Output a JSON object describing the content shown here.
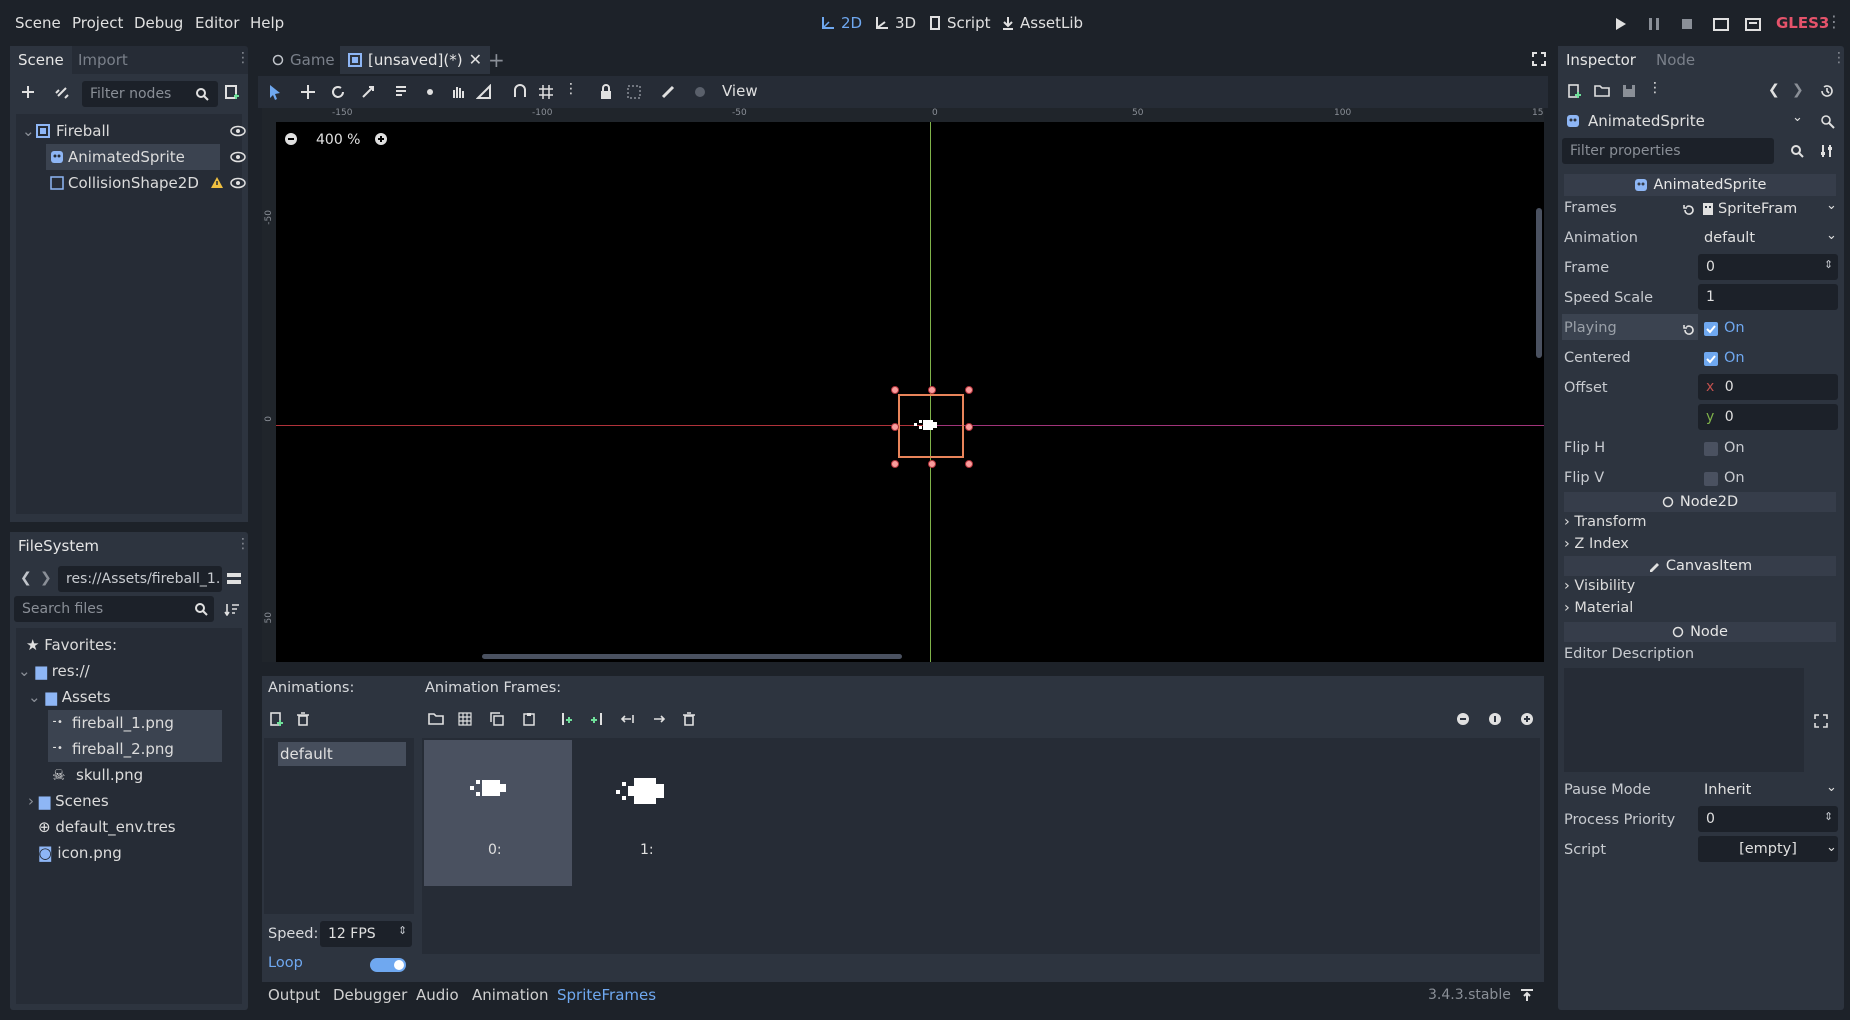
{
  "menu": {
    "scene": "Scene",
    "project": "Project",
    "debug": "Debug",
    "editor": "Editor",
    "help": "Help"
  },
  "workspaces": {
    "two_d": "2D",
    "three_d": "3D",
    "script": "Script",
    "assetlib": "AssetLib"
  },
  "renderer": "GLES3",
  "scene_dock": {
    "tab_scene": "Scene",
    "tab_import": "Import",
    "filter_placeholder": "Filter nodes",
    "nodes": [
      {
        "label": "Fireball",
        "icon": "node2d-icon"
      },
      {
        "label": "AnimatedSprite",
        "icon": "animated-sprite-icon"
      },
      {
        "label": "CollisionShape2D",
        "icon": "collision-shape-icon"
      }
    ]
  },
  "filesystem": {
    "title": "FileSystem",
    "path": "res://Assets/fireball_1.",
    "search_placeholder": "Search files",
    "favorites": "Favorites:",
    "root": "res://",
    "assets": "Assets",
    "files": [
      "fireball_1.png",
      "fireball_2.png",
      "skull.png"
    ],
    "scenes": "Scenes",
    "env": "default_env.tres",
    "icon_file": "icon.png"
  },
  "editor_tabs": {
    "game": "Game",
    "unsaved": "[unsaved](*)"
  },
  "toolbar": {
    "view": "View"
  },
  "viewport": {
    "zoom": "400 %",
    "ruler_top": [
      "-150",
      "-100",
      "-50",
      "0",
      "50",
      "100",
      "15"
    ],
    "ruler_left": [
      "-50",
      "0",
      "50"
    ]
  },
  "spriteframes": {
    "animations_label": "Animations:",
    "frames_label": "Animation Frames:",
    "animation_item": "default",
    "frame_labels": [
      "0:",
      "1:"
    ],
    "speed_label": "Speed:",
    "speed_value": "12 FPS",
    "loop_label": "Loop"
  },
  "bottom_tabs": {
    "output": "Output",
    "debugger": "Debugger",
    "audio": "Audio",
    "animation": "Animation",
    "spriteframes": "SpriteFrames"
  },
  "version": "3.4.3.stable",
  "inspector": {
    "tab_inspector": "Inspector",
    "tab_node": "Node",
    "object": "AnimatedSprite",
    "filter_placeholder": "Filter properties",
    "class_hdr": "AnimatedSprite",
    "props": {
      "frames": "Frames",
      "frames_val": "SpriteFram",
      "animation": "Animation",
      "animation_val": "default",
      "frame": "Frame",
      "frame_val": "0",
      "speed_scale": "Speed Scale",
      "speed_scale_val": "1",
      "playing": "Playing",
      "playing_val": "On",
      "centered": "Centered",
      "centered_val": "On",
      "offset": "Offset",
      "offset_x_label": "x",
      "offset_x": "0",
      "offset_y_label": "y",
      "offset_y": "0",
      "flip_h": "Flip H",
      "flip_h_val": "On",
      "flip_v": "Flip V",
      "flip_v_val": "On"
    },
    "node2d_hdr": "Node2D",
    "transform": "Transform",
    "z_index": "Z Index",
    "canvasitem_hdr": "CanvasItem",
    "visibility": "Visibility",
    "material": "Material",
    "node_hdr": "Node",
    "editor_description": "Editor Description",
    "pause_mode": "Pause Mode",
    "pause_mode_val": "Inherit",
    "process_priority": "Process Priority",
    "process_priority_val": "0",
    "script": "Script",
    "script_val": "[empty]"
  },
  "colors": {
    "accent": "#6fa8f0",
    "bg": "#1d2229",
    "panel": "#262c36",
    "warning": "#f0c040",
    "selection": "#e8845a"
  }
}
